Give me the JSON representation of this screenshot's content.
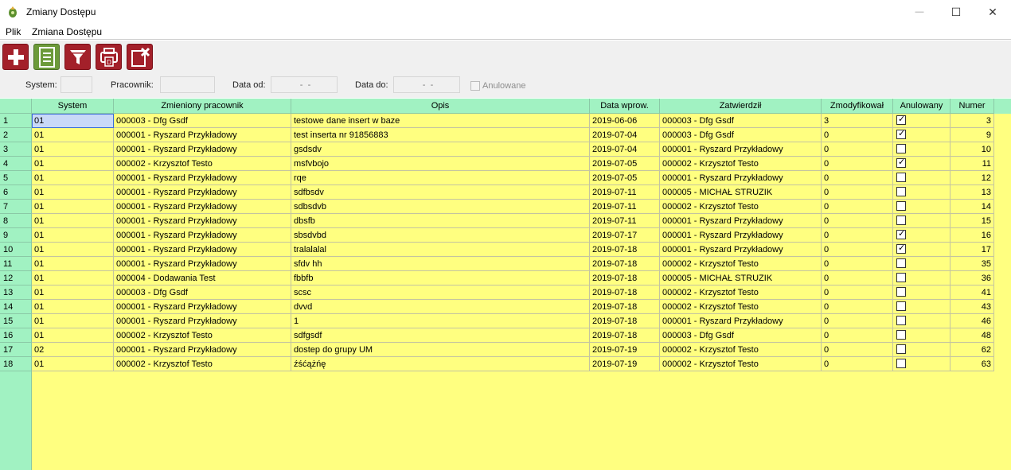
{
  "window": {
    "title": "Zmiany Dostępu",
    "controls": {
      "minimize": "—",
      "maximize": "☐",
      "close": "✕"
    }
  },
  "menu": {
    "items": [
      "Plik",
      "Zmiana Dostępu"
    ]
  },
  "toolbar": {
    "buttons": [
      "add-icon",
      "document-icon",
      "filter-icon",
      "print-icon",
      "close-document-icon"
    ]
  },
  "filters": {
    "system_label": "System:",
    "system_value": "",
    "employee_label": "Pracownik:",
    "employee_value": "",
    "date_from_label": "Data od:",
    "date_from_value": " -  -",
    "date_to_label": "Data do:",
    "date_to_value": " -  -",
    "cancelled_label": "Anulowane"
  },
  "colors": {
    "grid_bg": "#ffff80",
    "header_bg": "#a1f2c2",
    "toolbar_red": "#a3202a",
    "toolbar_green": "#6c9a3a"
  },
  "table": {
    "columns": [
      "System",
      "Zmieniony pracownik",
      "Opis",
      "Data wprow.",
      "Zatwierdził",
      "Zmodyfikował",
      "Anulowany",
      "Numer"
    ],
    "rows": [
      {
        "n": "1",
        "system": "01",
        "employee": "000003 - Dfg Gsdf",
        "desc": "testowe dane insert w baze",
        "date": "2019-06-06",
        "approved": "000003 - Dfg Gsdf",
        "modified": "3",
        "cancelled": true,
        "number": "3"
      },
      {
        "n": "2",
        "system": "01",
        "employee": "000001 - Ryszard Przykładowy",
        "desc": "test inserta nr 91856883",
        "date": "2019-07-04",
        "approved": "000003 - Dfg Gsdf",
        "modified": "0",
        "cancelled": true,
        "number": "9"
      },
      {
        "n": "3",
        "system": "01",
        "employee": "000001 - Ryszard Przykładowy",
        "desc": "gsdsdv",
        "date": "2019-07-04",
        "approved": "000001 - Ryszard Przykładowy",
        "modified": "0",
        "cancelled": false,
        "number": "10"
      },
      {
        "n": "4",
        "system": "01",
        "employee": "000002 - Krzysztof Testo",
        "desc": "msfvbojo",
        "date": "2019-07-05",
        "approved": "000002 - Krzysztof Testo",
        "modified": "0",
        "cancelled": true,
        "number": "11"
      },
      {
        "n": "5",
        "system": "01",
        "employee": "000001 - Ryszard Przykładowy",
        "desc": "rqe",
        "date": "2019-07-05",
        "approved": "000001 - Ryszard Przykładowy",
        "modified": "0",
        "cancelled": false,
        "number": "12"
      },
      {
        "n": "6",
        "system": "01",
        "employee": "000001 - Ryszard Przykładowy",
        "desc": "sdfbsdv",
        "date": "2019-07-11",
        "approved": "000005 - MICHAŁ STRUZIK",
        "modified": "0",
        "cancelled": false,
        "number": "13"
      },
      {
        "n": "7",
        "system": "01",
        "employee": "000001 - Ryszard Przykładowy",
        "desc": "sdbsdvb",
        "date": "2019-07-11",
        "approved": "000002 - Krzysztof Testo",
        "modified": "0",
        "cancelled": false,
        "number": "14"
      },
      {
        "n": "8",
        "system": "01",
        "employee": "000001 - Ryszard Przykładowy",
        "desc": "dbsfb",
        "date": "2019-07-11",
        "approved": "000001 - Ryszard Przykładowy",
        "modified": "0",
        "cancelled": false,
        "number": "15"
      },
      {
        "n": "9",
        "system": "01",
        "employee": "000001 - Ryszard Przykładowy",
        "desc": "sbsdvbd",
        "date": "2019-07-17",
        "approved": "000001 - Ryszard Przykładowy",
        "modified": "0",
        "cancelled": true,
        "number": "16"
      },
      {
        "n": "10",
        "system": "01",
        "employee": "000001 - Ryszard Przykładowy",
        "desc": "tralalalal",
        "date": "2019-07-18",
        "approved": "000001 - Ryszard Przykładowy",
        "modified": "0",
        "cancelled": true,
        "number": "17"
      },
      {
        "n": "11",
        "system": "01",
        "employee": "000001 - Ryszard Przykładowy",
        "desc": "sfdv hh",
        "date": "2019-07-18",
        "approved": "000002 - Krzysztof Testo",
        "modified": "0",
        "cancelled": false,
        "number": "35"
      },
      {
        "n": "12",
        "system": "01",
        "employee": "000004 - Dodawania Test",
        "desc": "fbbfb",
        "date": "2019-07-18",
        "approved": "000005 - MICHAŁ STRUZIK",
        "modified": "0",
        "cancelled": false,
        "number": "36"
      },
      {
        "n": "13",
        "system": "01",
        "employee": "000003 - Dfg Gsdf",
        "desc": "scsc",
        "date": "2019-07-18",
        "approved": "000002 - Krzysztof Testo",
        "modified": "0",
        "cancelled": false,
        "number": "41"
      },
      {
        "n": "14",
        "system": "01",
        "employee": "000001 - Ryszard Przykładowy",
        "desc": "dvvd",
        "date": "2019-07-18",
        "approved": "000002 - Krzysztof Testo",
        "modified": "0",
        "cancelled": false,
        "number": "43"
      },
      {
        "n": "15",
        "system": "01",
        "employee": "000001 - Ryszard Przykładowy",
        "desc": "1",
        "date": "2019-07-18",
        "approved": "000001 - Ryszard Przykładowy",
        "modified": "0",
        "cancelled": false,
        "number": "46"
      },
      {
        "n": "16",
        "system": "01",
        "employee": "000002 - Krzysztof Testo",
        "desc": "sdfgsdf",
        "date": "2019-07-18",
        "approved": "000003 - Dfg Gsdf",
        "modified": "0",
        "cancelled": false,
        "number": "48"
      },
      {
        "n": "17",
        "system": "02",
        "employee": "000001 - Ryszard Przykładowy",
        "desc": "dostep do grupy UM",
        "date": "2019-07-19",
        "approved": "000002 - Krzysztof Testo",
        "modified": "0",
        "cancelled": false,
        "number": "62"
      },
      {
        "n": "18",
        "system": "01",
        "employee": "000002 - Krzysztof Testo",
        "desc": "źśćążńę",
        "date": "2019-07-19",
        "approved": "000002 - Krzysztof Testo",
        "modified": "0",
        "cancelled": false,
        "number": "63"
      }
    ]
  }
}
